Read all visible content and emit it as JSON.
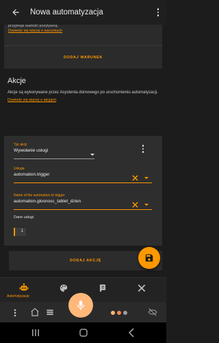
{
  "appbar": {
    "title": "Nowa automatyzacja"
  },
  "conditions": {
    "cut_text": "przyjmuje wartość pozytywną.",
    "learn_more": "Dowiedz się więcej o warunkach",
    "add_button": "DODAJ WARUNEK"
  },
  "actions_section": {
    "title": "Akcje",
    "description": "Akcje są wykonywane przez Asystenta domowego po uruchomieniu automatyzacji.",
    "learn_more": "Dowiedz się więcej o akcjach"
  },
  "action_card": {
    "type_label": "Typ akcji",
    "type_value": "Wywołanie usługi",
    "service_label": "Usługa",
    "service_value": "automation.trigger",
    "entity_label": "Name of the automation to trigger",
    "entity_value": "automation.glosnosc_tablet_dzien",
    "data_label": "Dane usługi",
    "data_value": "1"
  },
  "add_action_button": "DODAJ AKCJĘ",
  "bottom_nav": {
    "active_label": "Automatyzacje"
  },
  "keyboard": {
    "dots_colors": [
      "#ffb87a",
      "#f08a50",
      "#9e9e9e"
    ]
  },
  "colors": {
    "accent": "#ff9800",
    "background": "#1c1c1c",
    "card": "#2e2e2e"
  }
}
